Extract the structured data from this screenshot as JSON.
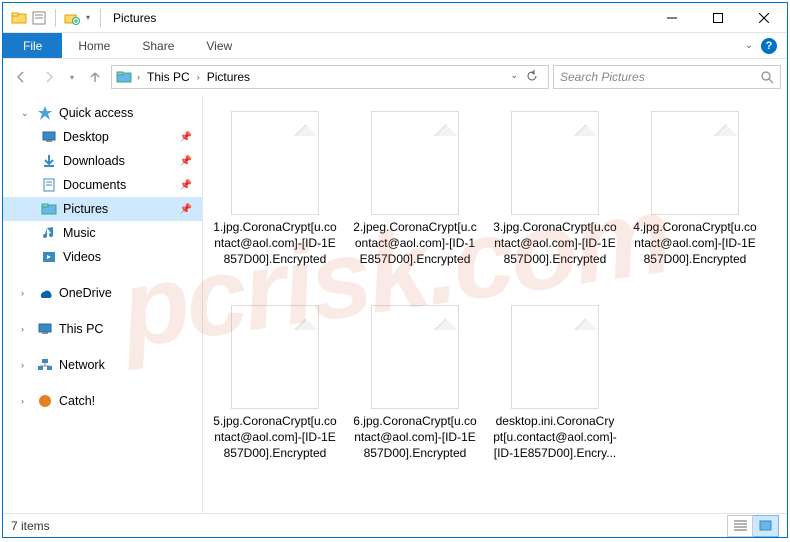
{
  "window": {
    "title": "Pictures"
  },
  "ribbon": {
    "file": "File",
    "tabs": [
      "Home",
      "Share",
      "View"
    ]
  },
  "breadcrumb": {
    "segments": [
      "This PC",
      "Pictures"
    ]
  },
  "search": {
    "placeholder": "Search Pictures"
  },
  "sidebar": {
    "quick_access": "Quick access",
    "quick_items": [
      {
        "label": "Desktop",
        "pinned": true
      },
      {
        "label": "Downloads",
        "pinned": true
      },
      {
        "label": "Documents",
        "pinned": true
      },
      {
        "label": "Pictures",
        "pinned": true,
        "selected": true
      },
      {
        "label": "Music",
        "pinned": false
      },
      {
        "label": "Videos",
        "pinned": false
      }
    ],
    "roots": [
      {
        "label": "OneDrive"
      },
      {
        "label": "This PC"
      },
      {
        "label": "Network"
      },
      {
        "label": "Catch!"
      }
    ]
  },
  "files": [
    {
      "name": "1.jpg.CoronaCrypt[u.contact@aol.com]-[ID-1E857D00].Encrypted"
    },
    {
      "name": "2.jpeg.CoronaCrypt[u.contact@aol.com]-[ID-1E857D00].Encrypted"
    },
    {
      "name": "3.jpg.CoronaCrypt[u.contact@aol.com]-[ID-1E857D00].Encrypted"
    },
    {
      "name": "4.jpg.CoronaCrypt[u.contact@aol.com]-[ID-1E857D00].Encrypted"
    },
    {
      "name": "5.jpg.CoronaCrypt[u.contact@aol.com]-[ID-1E857D00].Encrypted"
    },
    {
      "name": "6.jpg.CoronaCrypt[u.contact@aol.com]-[ID-1E857D00].Encrypted"
    },
    {
      "name": "desktop.ini.CoronaCrypt[u.contact@aol.com]-[ID-1E857D00].Encry..."
    }
  ],
  "status": {
    "text": "7 items"
  },
  "watermark": "pcrisk.com"
}
